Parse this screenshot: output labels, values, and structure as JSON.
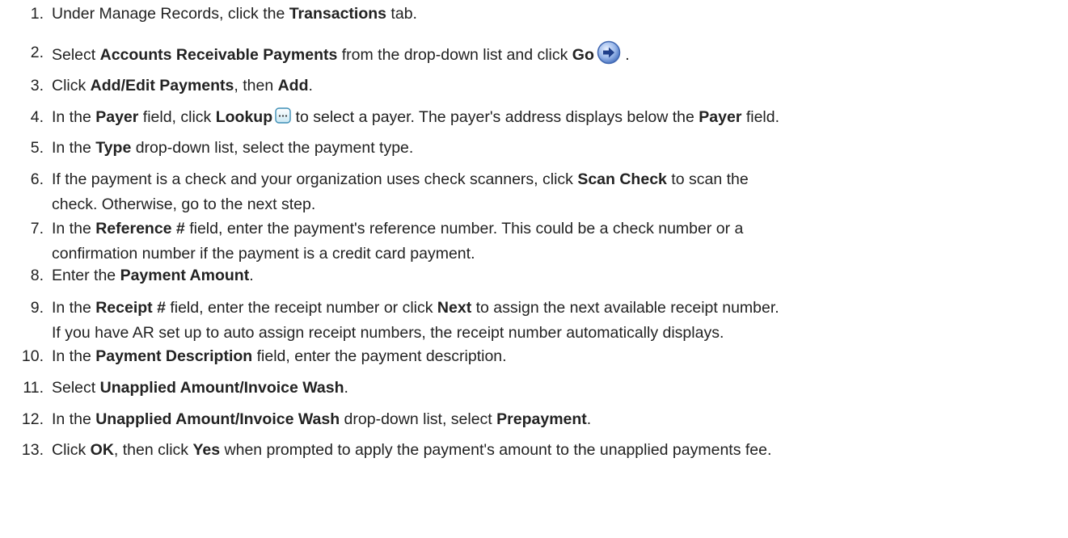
{
  "steps": [
    {
      "num": "1.",
      "parts": [
        {
          "t": "Under Manage Records, click the "
        },
        {
          "b": "Transactions"
        },
        {
          "t": " tab."
        }
      ]
    },
    {
      "num": "2.",
      "parts": [
        {
          "t": "Select "
        },
        {
          "b": "Accounts Receivable Payments"
        },
        {
          "t": " from the drop-down list and click "
        },
        {
          "b": "Go"
        },
        {
          "icon": "go-arrow-icon"
        },
        {
          "t": " ."
        }
      ]
    },
    {
      "num": "3.",
      "parts": [
        {
          "t": "Click "
        },
        {
          "b": "Add/Edit Payments"
        },
        {
          "t": ", then "
        },
        {
          "b": "Add"
        },
        {
          "t": "."
        }
      ]
    },
    {
      "num": "4.",
      "parts": [
        {
          "t": "In the "
        },
        {
          "b": "Payer"
        },
        {
          "t": " field, click "
        },
        {
          "b": "Lookup"
        },
        {
          "icon": "lookup-ellipsis-icon"
        },
        {
          "t": " to select a payer. The payer's address displays below the "
        },
        {
          "b": "Payer"
        },
        {
          "t": " field."
        }
      ]
    },
    {
      "num": "5.",
      "parts": [
        {
          "t": "In the "
        },
        {
          "b": "Type"
        },
        {
          "t": " drop-down list, select the payment type."
        }
      ]
    },
    {
      "num": "6.",
      "parts": [
        {
          "t": "If the payment is a check and your organization uses check scanners, click "
        },
        {
          "b": "Scan Check"
        },
        {
          "t": " to scan the"
        },
        {
          "br": true
        },
        {
          "t": "check. Otherwise, go to the next step."
        }
      ]
    },
    {
      "num": "7.",
      "parts": [
        {
          "t": "In the "
        },
        {
          "b": "Reference #"
        },
        {
          "t": " field, enter the payment's reference number. This could be a check number or a"
        },
        {
          "br": true
        },
        {
          "t": "confirmation number if the payment is a credit card payment."
        }
      ]
    },
    {
      "num": "8.",
      "parts": [
        {
          "t": "Enter the "
        },
        {
          "b": "Payment Amount"
        },
        {
          "t": "."
        }
      ]
    },
    {
      "num": "9.",
      "parts": [
        {
          "t": "In the "
        },
        {
          "b": "Receipt #"
        },
        {
          "t": " field, enter the receipt number or click "
        },
        {
          "b": "Next"
        },
        {
          "t": " to assign the next available receipt number."
        },
        {
          "br": true
        },
        {
          "t": "If you have AR set up to auto assign receipt numbers, the receipt number automatically displays."
        }
      ]
    },
    {
      "num": "10.",
      "parts": [
        {
          "t": "In the "
        },
        {
          "b": "Payment Description"
        },
        {
          "t": " field, enter the payment description."
        }
      ]
    },
    {
      "num": "11.",
      "parts": [
        {
          "t": "Select "
        },
        {
          "b": "Unapplied Amount/Invoice Wash"
        },
        {
          "t": "."
        }
      ]
    },
    {
      "num": "12.",
      "parts": [
        {
          "t": "In the "
        },
        {
          "b": "Unapplied Amount/Invoice Wash"
        },
        {
          "t": " drop-down list, select "
        },
        {
          "b": "Prepayment"
        },
        {
          "t": "."
        }
      ]
    },
    {
      "num": "13.",
      "parts": [
        {
          "t": "Click "
        },
        {
          "b": "OK"
        },
        {
          "t": ", then click "
        },
        {
          "b": "Yes"
        },
        {
          "t": " when prompted to apply the payment's amount to the unapplied payments fee."
        }
      ]
    }
  ]
}
